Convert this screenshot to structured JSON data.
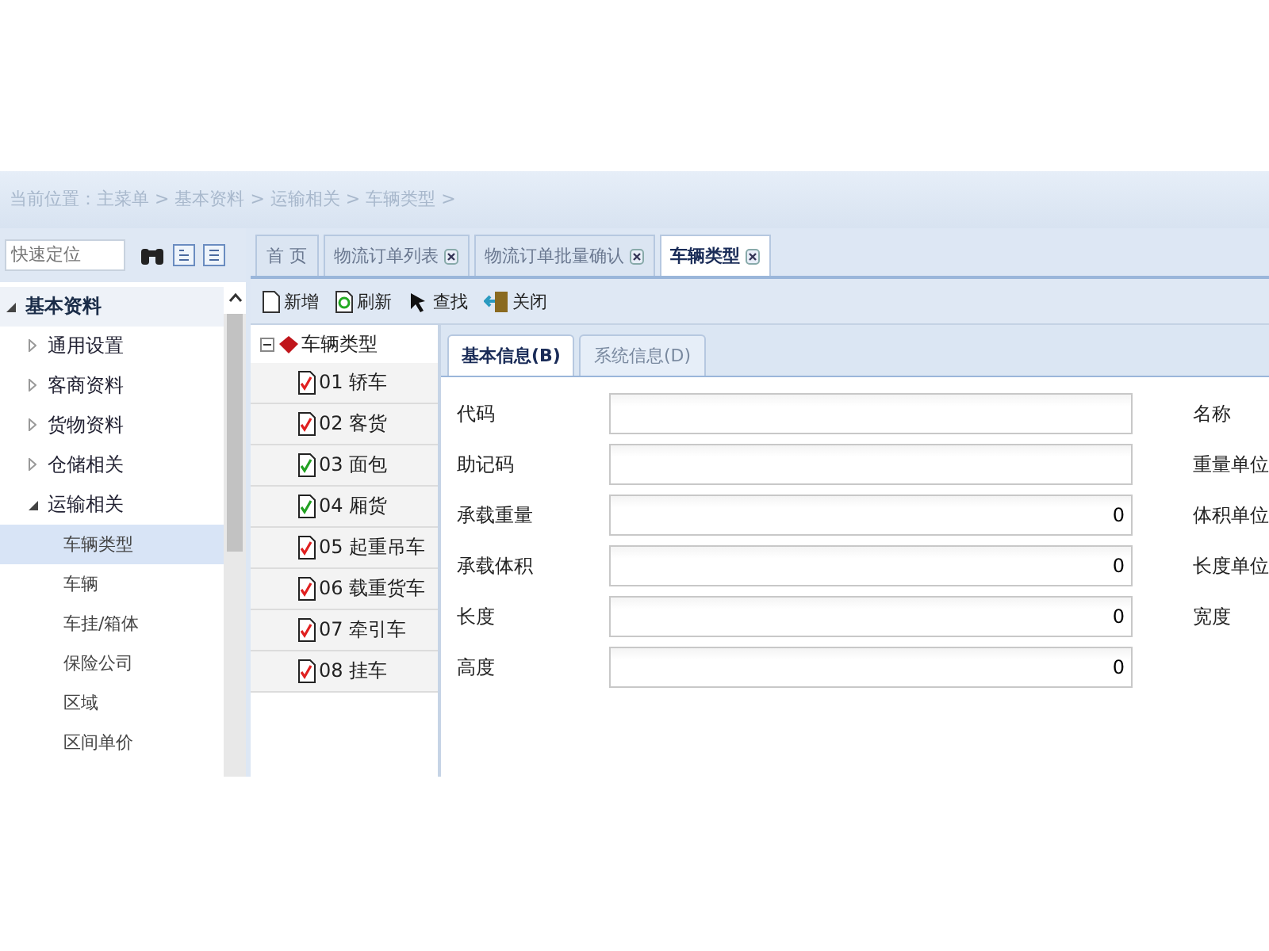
{
  "breadcrumb": "当前位置：主菜单 > 基本资料 > 运输相关 > 车辆类型 >",
  "sidebar": {
    "search": {
      "placeholder": "快速定位"
    },
    "tree": [
      {
        "label": "基本资料",
        "expanded": true,
        "selected": false,
        "children": [
          {
            "label": "通用设置",
            "expanded": false,
            "selected": false
          },
          {
            "label": "客商资料",
            "expanded": false,
            "selected": false
          },
          {
            "label": "货物资料",
            "expanded": false,
            "selected": false
          },
          {
            "label": "仓储相关",
            "expanded": false,
            "selected": false
          },
          {
            "label": "运输相关",
            "expanded": true,
            "selected": false,
            "children": [
              {
                "label": "车辆类型",
                "selected": true
              },
              {
                "label": "车辆",
                "selected": false
              },
              {
                "label": "车挂/箱体",
                "selected": false
              },
              {
                "label": "保险公司",
                "selected": false
              },
              {
                "label": "区域",
                "selected": false
              },
              {
                "label": "区间单价",
                "selected": false
              }
            ]
          }
        ]
      }
    ]
  },
  "tabs": [
    {
      "label": "首 页",
      "closable": false,
      "selected": false
    },
    {
      "label": "物流订单列表",
      "closable": true,
      "selected": false
    },
    {
      "label": "物流订单批量确认",
      "closable": true,
      "selected": false
    },
    {
      "label": "车辆类型",
      "closable": true,
      "selected": true
    }
  ],
  "toolbar": [
    {
      "label": "新增",
      "kind": "new"
    },
    {
      "label": "刷新",
      "kind": "refresh"
    },
    {
      "label": "查找",
      "kind": "find"
    },
    {
      "label": "关闭",
      "kind": "close"
    }
  ],
  "type_tree": {
    "root": "车辆类型",
    "expanded": true,
    "items": [
      {
        "label": "01 轿车",
        "color": "#e02020"
      },
      {
        "label": "02 客货",
        "color": "#e02020"
      },
      {
        "label": "03 面包",
        "color": "#22a022"
      },
      {
        "label": "04 厢货",
        "color": "#22a022"
      },
      {
        "label": "05 起重吊车",
        "color": "#e02020"
      },
      {
        "label": "06 载重货车",
        "color": "#e02020"
      },
      {
        "label": "07 牵引车",
        "color": "#e02020"
      },
      {
        "label": "08 挂车",
        "color": "#e02020"
      }
    ]
  },
  "form_tabs": [
    {
      "label": "基本信息(B)",
      "selected": true
    },
    {
      "label": "系统信息(D)",
      "selected": false
    }
  ],
  "fields": [
    {
      "label": "代码"
    },
    {
      "label": "助记码"
    },
    {
      "label": "承载重量",
      "value": "0"
    },
    {
      "label": "承载体积",
      "value": "0"
    },
    {
      "label": "长度",
      "value": "0"
    },
    {
      "label": "高度",
      "value": "0"
    }
  ],
  "right_labels": [
    "名称",
    "重量单位",
    "体积单位",
    "长度单位",
    "宽度"
  ]
}
